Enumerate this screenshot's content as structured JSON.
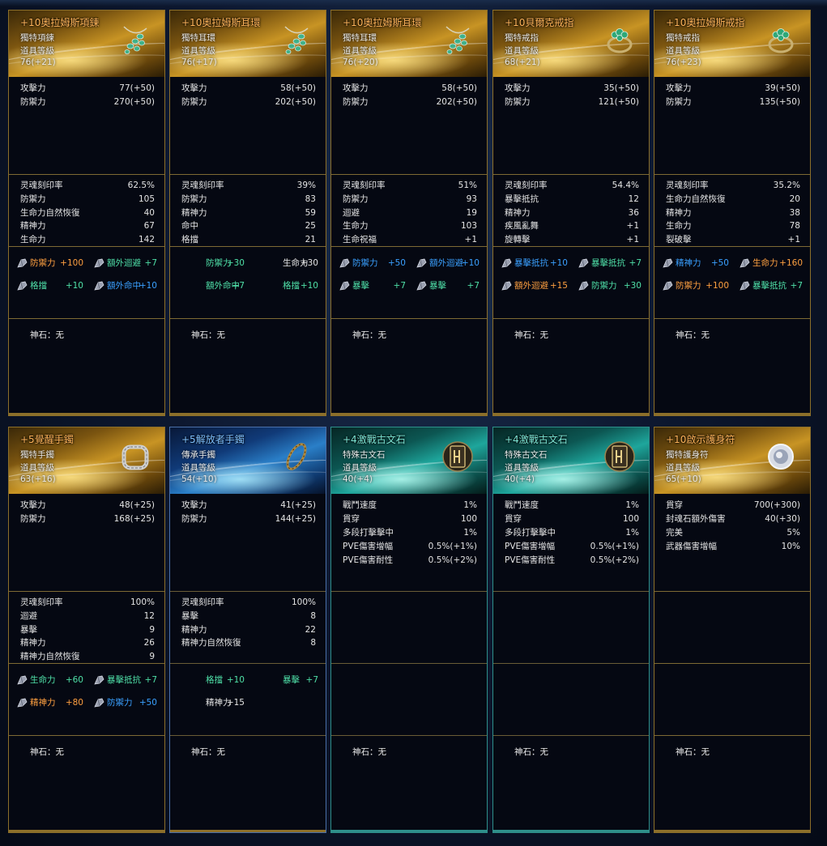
{
  "cards": [
    {
      "name": "+10奧拉姆斯項鍊",
      "type": "獨特項鍊",
      "level_label": "道具等級",
      "level": "76(+21)",
      "base": [
        {
          "k": "攻擊力",
          "v": "77(+50)"
        },
        {
          "k": "防禦力",
          "v": "270(+50)"
        }
      ],
      "stats": [
        {
          "k": "灵魂刻印率",
          "v": "62.5%"
        },
        {
          "k": "防禦力",
          "v": "105"
        },
        {
          "k": "生命力自然恢復",
          "v": "40"
        },
        {
          "k": "精神力",
          "v": "67"
        },
        {
          "k": "生命力",
          "v": "142"
        }
      ],
      "gems": [
        {
          "k": "防禦力",
          "v": "+100",
          "c": "orange",
          "icon": true
        },
        {
          "k": "額外迴避",
          "v": "+7",
          "c": "green",
          "icon": true
        },
        {
          "k": "格擋",
          "v": "+10",
          "c": "green",
          "icon": true
        },
        {
          "k": "額外命中",
          "v": "+10",
          "c": "blue",
          "icon": true
        }
      ],
      "god": "神石：无"
    },
    {
      "name": "+10奧拉姆斯耳環",
      "type": "獨特耳環",
      "level_label": "道具等級",
      "level": "76(+17)",
      "base": [
        {
          "k": "攻擊力",
          "v": "58(+50)"
        },
        {
          "k": "防禦力",
          "v": "202(+50)"
        }
      ],
      "stats": [
        {
          "k": "灵魂刻印率",
          "v": "39%"
        },
        {
          "k": "防禦力",
          "v": "83"
        },
        {
          "k": "精神力",
          "v": "59"
        },
        {
          "k": "命中",
          "v": "25"
        },
        {
          "k": "格擋",
          "v": "21"
        }
      ],
      "gems": [
        {
          "k": "防禦力",
          "v": "+30",
          "c": "green",
          "icon": false
        },
        {
          "k": "生命力",
          "v": "+30",
          "c": "white",
          "icon": false
        },
        {
          "k": "額外命中",
          "v": "+7",
          "c": "green",
          "icon": false
        },
        {
          "k": "格擋",
          "v": "+10",
          "c": "green",
          "icon": false
        }
      ],
      "god": "神石：无"
    },
    {
      "name": "+10奧拉姆斯耳環",
      "type": "獨特耳環",
      "level_label": "道具等級",
      "level": "76(+20)",
      "base": [
        {
          "k": "攻擊力",
          "v": "58(+50)"
        },
        {
          "k": "防禦力",
          "v": "202(+50)"
        }
      ],
      "stats": [
        {
          "k": "灵魂刻印率",
          "v": "51%"
        },
        {
          "k": "防禦力",
          "v": "93"
        },
        {
          "k": "迴避",
          "v": "19"
        },
        {
          "k": "生命力",
          "v": "103"
        },
        {
          "k": "生命祝福",
          "v": "+1"
        }
      ],
      "gems": [
        {
          "k": "防禦力",
          "v": "+50",
          "c": "blue",
          "icon": true
        },
        {
          "k": "額外迴避",
          "v": "+10",
          "c": "blue",
          "icon": true
        },
        {
          "k": "暴擊",
          "v": "+7",
          "c": "green",
          "icon": true
        },
        {
          "k": "暴擊",
          "v": "+7",
          "c": "green",
          "icon": true
        }
      ],
      "god": "神石：无"
    },
    {
      "name": "+10貝爾克戒指",
      "type": "獨特戒指",
      "level_label": "道具等級",
      "level": "68(+21)",
      "base": [
        {
          "k": "攻擊力",
          "v": "35(+50)"
        },
        {
          "k": "防禦力",
          "v": "121(+50)"
        }
      ],
      "stats": [
        {
          "k": "灵魂刻印率",
          "v": "54.4%"
        },
        {
          "k": "暴擊抵抗",
          "v": "12"
        },
        {
          "k": "精神力",
          "v": "36"
        },
        {
          "k": "疾風亂舞",
          "v": "+1"
        },
        {
          "k": "旋轉擊",
          "v": "+1"
        }
      ],
      "gems": [
        {
          "k": "暴擊抵抗",
          "v": "+10",
          "c": "blue",
          "icon": true
        },
        {
          "k": "暴擊抵抗",
          "v": "+7",
          "c": "green",
          "icon": true
        },
        {
          "k": "額外迴避",
          "v": "+15",
          "c": "orange",
          "icon": true
        },
        {
          "k": "防禦力",
          "v": "+30",
          "c": "green",
          "icon": true
        }
      ],
      "god": "神石：无"
    },
    {
      "name": "+10奧拉姆斯戒指",
      "type": "獨特戒指",
      "level_label": "道具等級",
      "level": "76(+23)",
      "base": [
        {
          "k": "攻擊力",
          "v": "39(+50)"
        },
        {
          "k": "防禦力",
          "v": "135(+50)"
        }
      ],
      "stats": [
        {
          "k": "灵魂刻印率",
          "v": "35.2%"
        },
        {
          "k": "生命力自然恢復",
          "v": "20"
        },
        {
          "k": "精神力",
          "v": "38"
        },
        {
          "k": "生命力",
          "v": "78"
        },
        {
          "k": "裂破擊",
          "v": "+1"
        }
      ],
      "gems": [
        {
          "k": "精神力",
          "v": "+50",
          "c": "blue",
          "icon": true
        },
        {
          "k": "生命力",
          "v": "+160",
          "c": "orange",
          "icon": true
        },
        {
          "k": "防禦力",
          "v": "+100",
          "c": "orange",
          "icon": true
        },
        {
          "k": "暴擊抵抗",
          "v": "+7",
          "c": "green",
          "icon": true
        }
      ],
      "god": "神石：无"
    },
    {
      "name": "+5覺醒手鐲",
      "type": "獨特手鐲",
      "level_label": "道具等級",
      "level": "63(+16)",
      "base": [
        {
          "k": "攻擊力",
          "v": "48(+25)"
        },
        {
          "k": "防禦力",
          "v": "168(+25)"
        }
      ],
      "stats": [
        {
          "k": "灵魂刻印率",
          "v": "100%"
        },
        {
          "k": "迴避",
          "v": "12"
        },
        {
          "k": "暴擊",
          "v": "9"
        },
        {
          "k": "精神力",
          "v": "26"
        },
        {
          "k": "精神力自然恢復",
          "v": "9"
        }
      ],
      "gems": [
        {
          "k": "生命力",
          "v": "+60",
          "c": "green",
          "icon": true
        },
        {
          "k": "暴擊抵抗",
          "v": "+7",
          "c": "green",
          "icon": true
        },
        {
          "k": "精神力",
          "v": "+80",
          "c": "orange",
          "icon": true
        },
        {
          "k": "防禦力",
          "v": "+50",
          "c": "blue",
          "icon": true
        }
      ],
      "god": "神石：无"
    },
    {
      "name": "+5解放者手鐲",
      "type": "傳承手鐲",
      "level_label": "道具等級",
      "level": "54(+10)",
      "base": [
        {
          "k": "攻擊力",
          "v": "41(+25)"
        },
        {
          "k": "防禦力",
          "v": "144(+25)"
        }
      ],
      "stats": [
        {
          "k": "灵魂刻印率",
          "v": "100%"
        },
        {
          "k": "暴擊",
          "v": "8"
        },
        {
          "k": "精神力",
          "v": "22"
        },
        {
          "k": "精神力自然恢復",
          "v": "8"
        }
      ],
      "gems": [
        {
          "k": "格擋",
          "v": "+10",
          "c": "green",
          "icon": false
        },
        {
          "k": "暴擊",
          "v": "+7",
          "c": "green",
          "icon": false
        },
        {
          "k": "精神力",
          "v": "+15",
          "c": "white",
          "icon": false
        }
      ],
      "god": "神石：无"
    },
    {
      "name": "+4激戰古文石",
      "type": "特殊古文石",
      "level_label": "道具等級",
      "level": "40(+4)",
      "base": [
        {
          "k": "戰鬥速度",
          "v": "1%"
        },
        {
          "k": "貫穿",
          "v": "100"
        },
        {
          "k": "多段打擊擊中",
          "v": "1%"
        },
        {
          "k": "PVE傷害增幅",
          "v": "0.5%(+1%)"
        },
        {
          "k": "PVE傷害耐性",
          "v": "0.5%(+2%)"
        }
      ],
      "stats": [],
      "gems": [],
      "god": "神石：无"
    },
    {
      "name": "+4激戰古文石",
      "type": "特殊古文石",
      "level_label": "道具等級",
      "level": "40(+4)",
      "base": [
        {
          "k": "戰鬥速度",
          "v": "1%"
        },
        {
          "k": "貫穿",
          "v": "100"
        },
        {
          "k": "多段打擊擊中",
          "v": "1%"
        },
        {
          "k": "PVE傷害增幅",
          "v": "0.5%(+1%)"
        },
        {
          "k": "PVE傷害耐性",
          "v": "0.5%(+2%)"
        }
      ],
      "stats": [],
      "gems": [],
      "god": "神石：无"
    },
    {
      "name": "+10啟示護身符",
      "type": "獨特護身符",
      "level_label": "道具等級",
      "level": "65(+10)",
      "base": [
        {
          "k": "貫穿",
          "v": "700(+300)"
        },
        {
          "k": "封魂石額外傷害",
          "v": "40(+30)"
        },
        {
          "k": "完美",
          "v": "5%"
        },
        {
          "k": "武器傷害增幅",
          "v": "10%"
        }
      ],
      "stats": [],
      "gems": [],
      "god": "神石：无"
    }
  ],
  "colors": {
    "orange": "#ffa040",
    "green": "#4fe0a8",
    "blue": "#3aa0ff",
    "white": "#e4e4e4"
  }
}
